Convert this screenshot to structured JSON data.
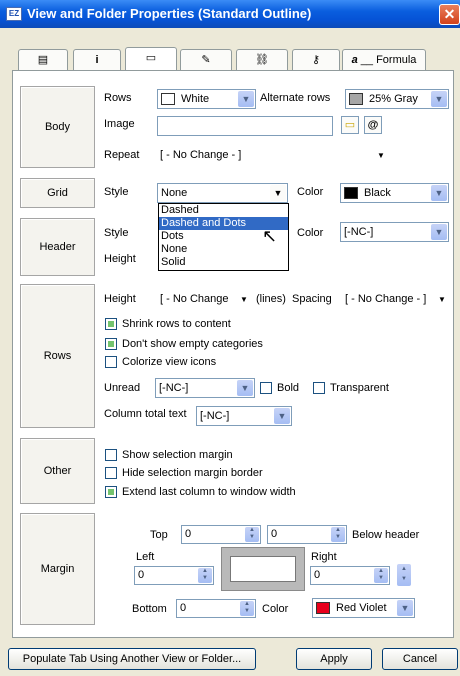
{
  "window": {
    "title": "View and Folder Properties (Standard Outline)",
    "app_icon": "EZ",
    "close_glyph": "✕"
  },
  "tabs": [
    {
      "label": "",
      "icon": "list-icon"
    },
    {
      "label": "i",
      "icon": "info-icon"
    },
    {
      "label": "",
      "icon": "table-icon"
    },
    {
      "label": "",
      "icon": "pen-icon"
    },
    {
      "label": "",
      "icon": "hierarchy-icon"
    },
    {
      "label": "",
      "icon": "key-icon"
    },
    {
      "label": "a",
      "icon": "font-icon"
    },
    {
      "label": "Formula"
    }
  ],
  "body": {
    "section": "Body",
    "rows_label": "Rows",
    "rows_value": "White",
    "alt_rows_label": "Alternate rows",
    "alt_rows_value": "25% Gray",
    "alt_rows_color": "#a6a6a6",
    "image_label": "Image",
    "image_value": "",
    "repeat_label": "Repeat",
    "repeat_value": "[ - No Change - ]"
  },
  "grid": {
    "section": "Grid",
    "style_label": "Style",
    "style_value": "None",
    "color_label": "Color",
    "color_value": "Black",
    "color_hex": "#000000",
    "options": [
      "Dashed",
      "Dashed and Dots",
      "Dots",
      "None",
      "Solid"
    ],
    "highlighted_option": "Dashed and Dots"
  },
  "header": {
    "section": "Header",
    "style_label": "Style",
    "height_label": "Height",
    "color_label": "Color",
    "color_value": "[-NC-]"
  },
  "rows": {
    "section": "Rows",
    "height_label": "Height",
    "height_value": "[ - No Change",
    "lines_label": "(lines)",
    "spacing_label": "Spacing",
    "spacing_value": "[ - No Change - ]",
    "shrink_label": "Shrink rows to content",
    "empty_label": "Don't show empty categories",
    "colorize_label": "Colorize view icons",
    "unread_label": "Unread",
    "unread_value": "[-NC-]",
    "bold_label": "Bold",
    "transparent_label": "Transparent",
    "total_label": "Column total text",
    "total_value": "[-NC-]"
  },
  "other": {
    "section": "Other",
    "show_margin": "Show selection margin",
    "hide_border": "Hide selection margin border",
    "extend_last": "Extend last column to window width"
  },
  "margin": {
    "section": "Margin",
    "top_label": "Top",
    "top_value": "0",
    "below_value": "0",
    "below_label": "Below header",
    "left_label": "Left",
    "left_value": "0",
    "right_label": "Right",
    "right_value": "0",
    "bottom_label": "Bottom",
    "bottom_value": "0",
    "color_label": "Color",
    "color_value": "Red Violet",
    "color_hex": "#e8001c"
  },
  "footer": {
    "populate_label": "Populate Tab Using Another View or Folder...",
    "apply_label": "Apply",
    "cancel_label": "Cancel"
  }
}
